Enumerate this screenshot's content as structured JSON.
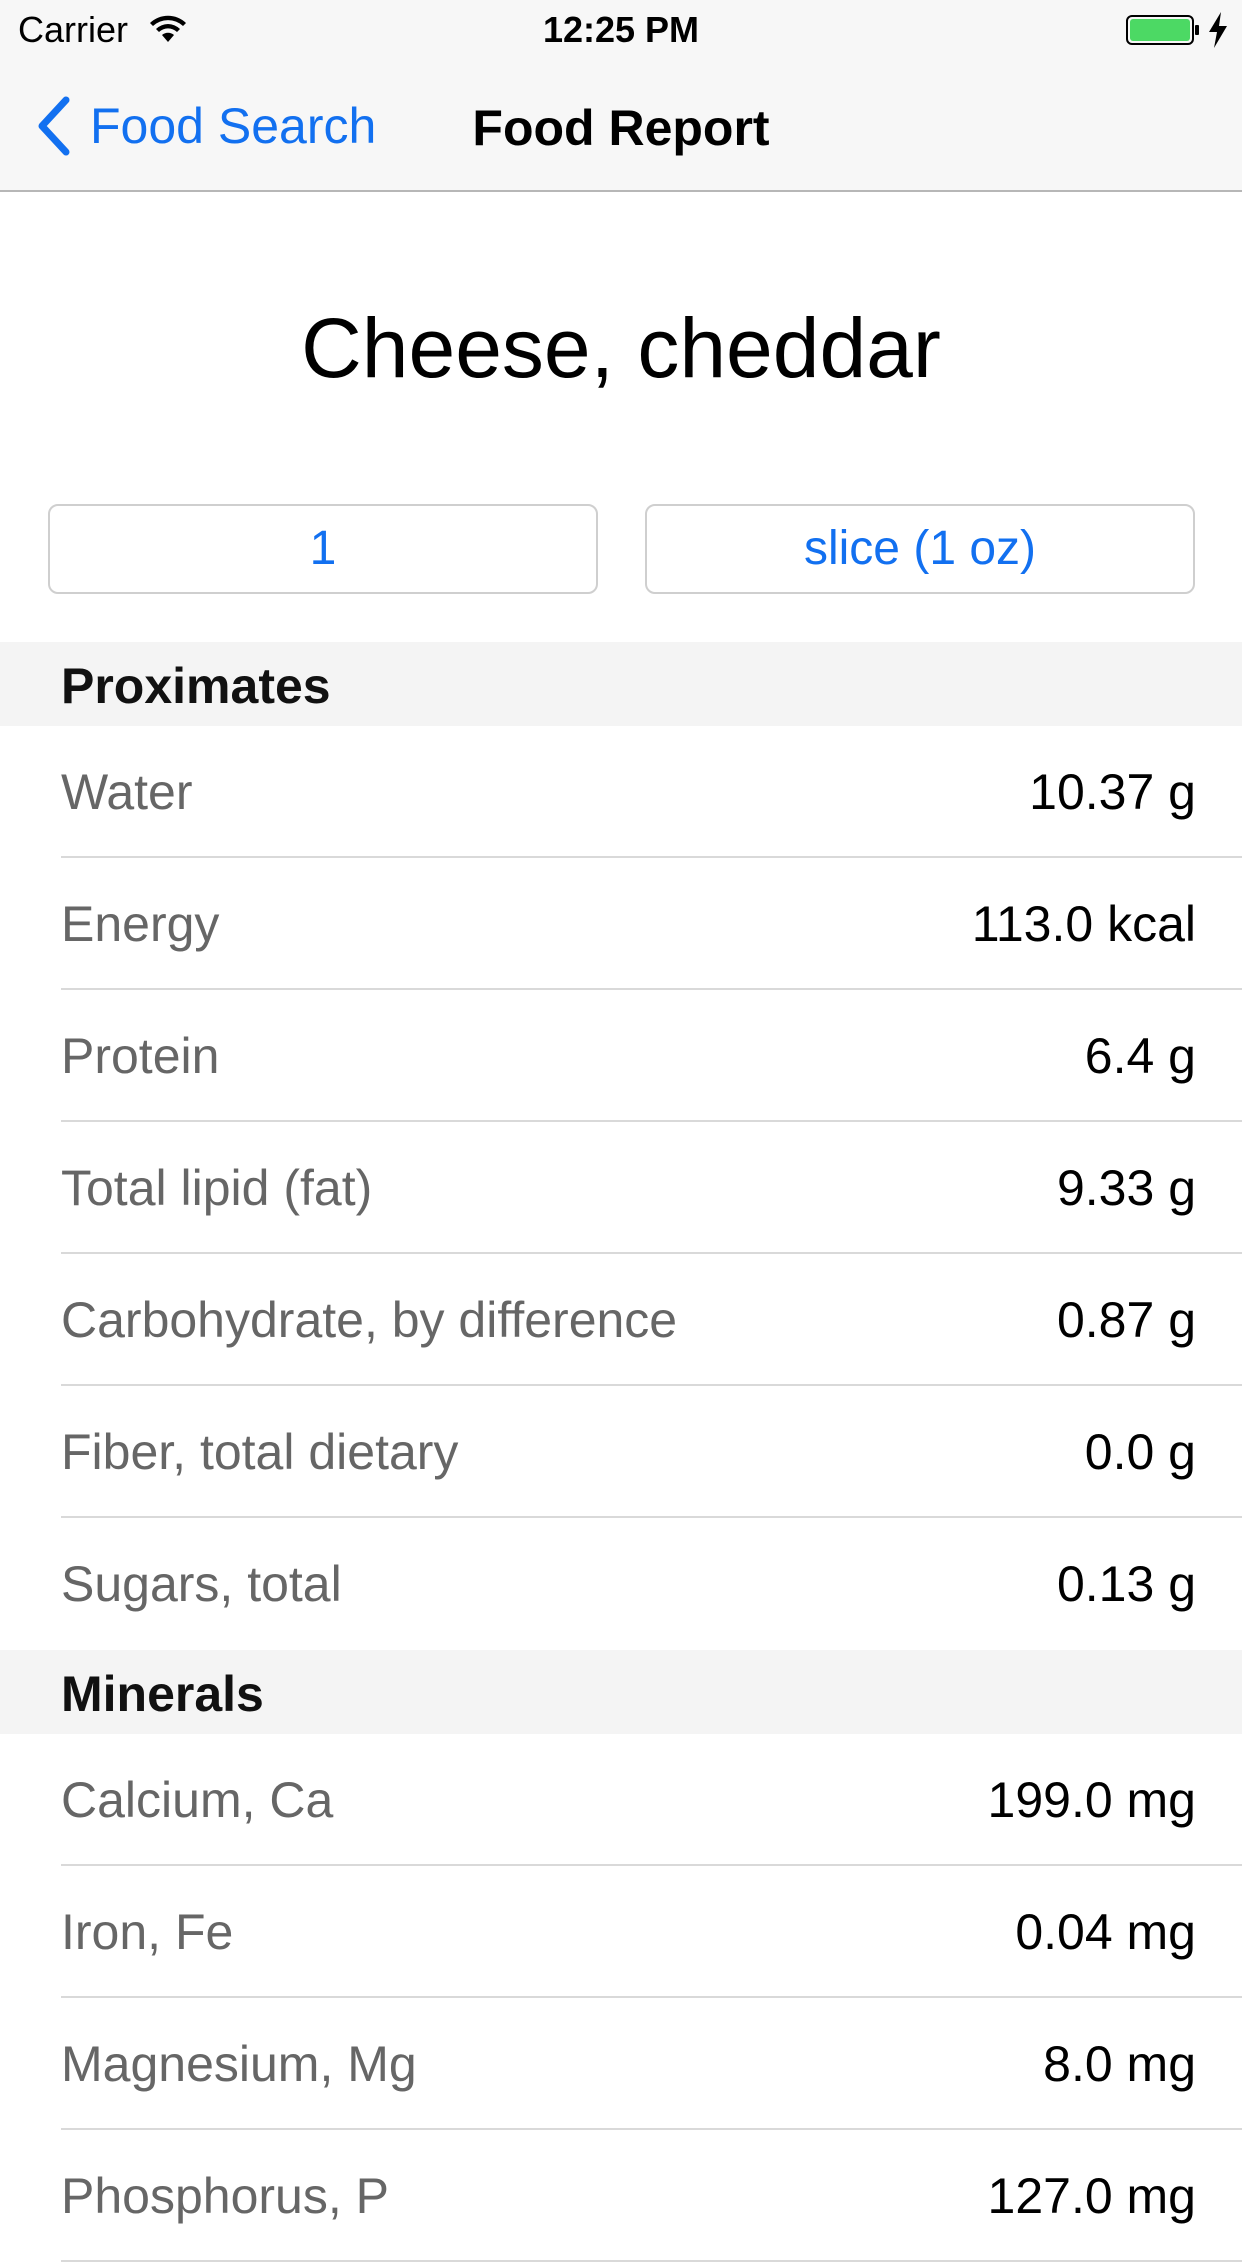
{
  "status_bar": {
    "carrier": "Carrier",
    "time": "12:25 PM",
    "battery_color": "#4cd964"
  },
  "nav": {
    "back_label": "Food Search",
    "title": "Food Report",
    "accent_color": "#1270f0"
  },
  "food": {
    "name": "Cheese, cheddar",
    "quantity": "1",
    "unit": "slice (1 oz)"
  },
  "sections": [
    {
      "title": "Proximates",
      "rows": [
        {
          "label": "Water",
          "value": "10.37 g"
        },
        {
          "label": "Energy",
          "value": "113.0 kcal"
        },
        {
          "label": "Protein",
          "value": "6.4 g"
        },
        {
          "label": "Total lipid (fat)",
          "value": "9.33 g"
        },
        {
          "label": "Carbohydrate, by difference",
          "value": "0.87 g"
        },
        {
          "label": "Fiber, total dietary",
          "value": "0.0 g"
        },
        {
          "label": "Sugars, total",
          "value": "0.13 g"
        }
      ]
    },
    {
      "title": "Minerals",
      "rows": [
        {
          "label": "Calcium, Ca",
          "value": "199.0 mg"
        },
        {
          "label": "Iron, Fe",
          "value": "0.04 mg"
        },
        {
          "label": "Magnesium, Mg",
          "value": "8.0 mg"
        },
        {
          "label": "Phosphorus, P",
          "value": "127.0 mg"
        }
      ]
    }
  ]
}
